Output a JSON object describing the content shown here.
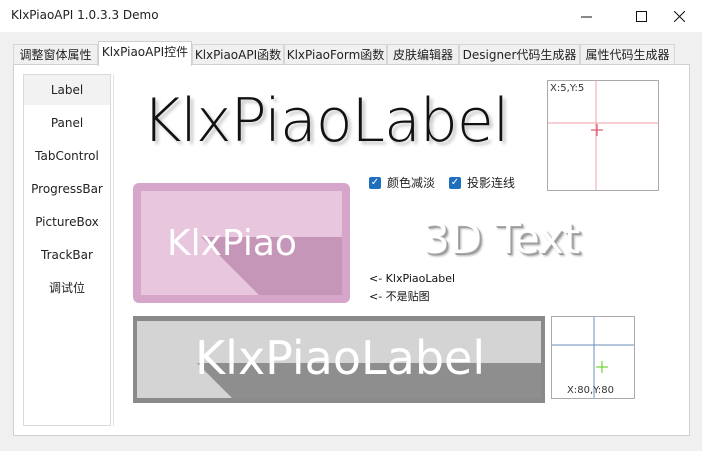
{
  "window": {
    "title": "KlxPiaoAPI 1.0.3.3 Demo"
  },
  "tabs": [
    {
      "label": "调整窗体属性"
    },
    {
      "label": "KlxPiaoAPI控件"
    },
    {
      "label": "KlxPiaoAPI函数"
    },
    {
      "label": "KlxPiaoForm函数"
    },
    {
      "label": "皮肤编辑器"
    },
    {
      "label": "Designer代码生成器"
    },
    {
      "label": "属性代码生成器"
    }
  ],
  "nav": [
    {
      "label": "Label"
    },
    {
      "label": "Panel"
    },
    {
      "label": "TabControl"
    },
    {
      "label": "ProgressBar"
    },
    {
      "label": "PictureBox"
    },
    {
      "label": "TrackBar"
    },
    {
      "label": "调试位"
    }
  ],
  "demo": {
    "big_label": "KlxPiaoLabel",
    "pink_label": "KlxPiao",
    "text3d": "3D Text",
    "gray_label": "KlxPiaoLabel",
    "note1": "<- KlxPiaoLabel",
    "note2": "<- 不是贴图",
    "coord_top": "X:5,Y:5",
    "coord_bottom": "X:80,Y:80",
    "check_color": "颜色减淡",
    "check_shadow": "投影连线"
  },
  "colors": {
    "accent": "#1f6fbf",
    "pink": "#d5a6c9",
    "crosshair_red": "#e05a6a",
    "crosshair_blue": "#6a8fb8",
    "crosshair_green": "#6fd23a"
  }
}
